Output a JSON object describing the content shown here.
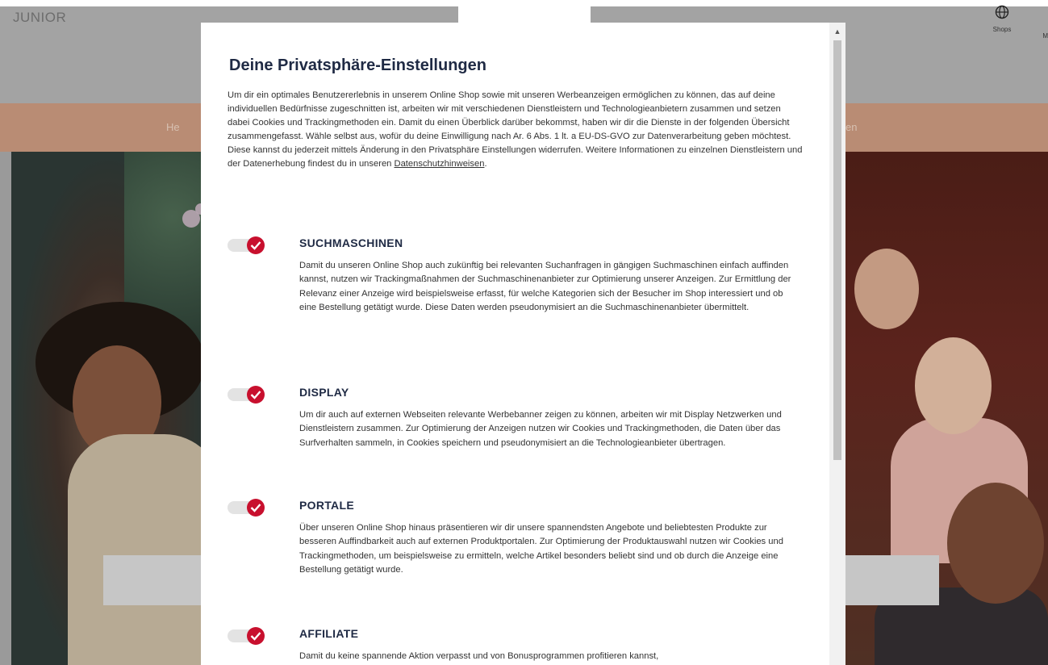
{
  "site": {
    "logo": "JUNIOR",
    "shops_label": "Shops",
    "more_label": "M",
    "nav_left": "He",
    "nav_right": "en"
  },
  "modal": {
    "title": "Deine Privatsphäre-Einstellungen",
    "intro": "Um dir ein optimales Benutzererlebnis in unserem Online Shop sowie mit unseren Werbeanzeigen ermöglichen zu können, das auf deine individuellen Bedürfnisse zugeschnitten ist, arbeiten wir mit verschiedenen Dienstleistern und Technologieanbietern zusammen und setzen dabei Cookies und Trackingmethoden ein. Damit du einen Überblick darüber bekommst, haben wir dir die Dienste in der folgenden Übersicht zusammengefasst. Wähle selbst aus, wofür du deine Einwilligung nach Ar. 6 Abs. 1 lt. a EU-DS-GVO zur Datenverarbeitung geben möchtest. Diese kannst du jederzeit mittels Änderung in den Privatsphäre Einstellungen widerrufen. Weitere Informationen zu einzelnen Dienstleistern und der Datenerhebung findest du in unseren",
    "privacy_link": "Datenschutzhinweisen",
    "intro_end": ".",
    "sections": [
      {
        "title": "SUCHMASCHINEN",
        "text": "Damit du unseren Online Shop auch zukünftig bei relevanten Suchanfragen in gängigen Suchmaschinen einfach auffinden kannst, nutzen wir Trackingmaßnahmen der Suchmaschinenanbieter zur Optimierung unserer Anzeigen. Zur Ermittlung der Relevanz einer Anzeige wird beispielsweise erfasst, für welche Kategorien sich der Besucher im Shop interessiert und ob eine Bestellung getätigt wurde. Diese Daten werden pseudonymisiert an die Suchmaschinenanbieter übermittelt.",
        "enabled": true
      },
      {
        "title": "DISPLAY",
        "text": "Um dir auch auf externen Webseiten relevante Werbebanner zeigen zu können, arbeiten wir mit Display Netzwerken und Dienstleistern zusammen. Zur Optimierung der Anzeigen nutzen wir Cookies und Trackingmethoden, die Daten über das Surfverhalten sammeln, in Cookies speichern und pseudonymisiert an die Technologieanbieter übertragen.",
        "enabled": true
      },
      {
        "title": "PORTALE",
        "text": "Über unseren Online Shop hinaus präsentieren wir dir unsere spannendsten Angebote und beliebtesten Produkte zur besseren Auffindbarkeit auch auf externen Produktportalen. Zur Optimierung der Produktauswahl nutzen wir Cookies und Trackingmethoden, um beispielsweise zu ermitteln, welche Artikel besonders beliebt sind und ob durch die Anzeige eine Bestellung getätigt wurde.",
        "enabled": true
      },
      {
        "title": "AFFILIATE",
        "text": "Damit du keine spannende Aktion verpasst und von Bonusprogrammen profitieren kannst,",
        "enabled": true
      }
    ]
  },
  "colors": {
    "accent": "#c8102e",
    "title": "#1f2a44",
    "nav_bar": "#b98c74"
  },
  "icons": {
    "shops": "globe-icon",
    "toggle_check": "check-icon",
    "scroll_up": "chevron-up-icon"
  }
}
